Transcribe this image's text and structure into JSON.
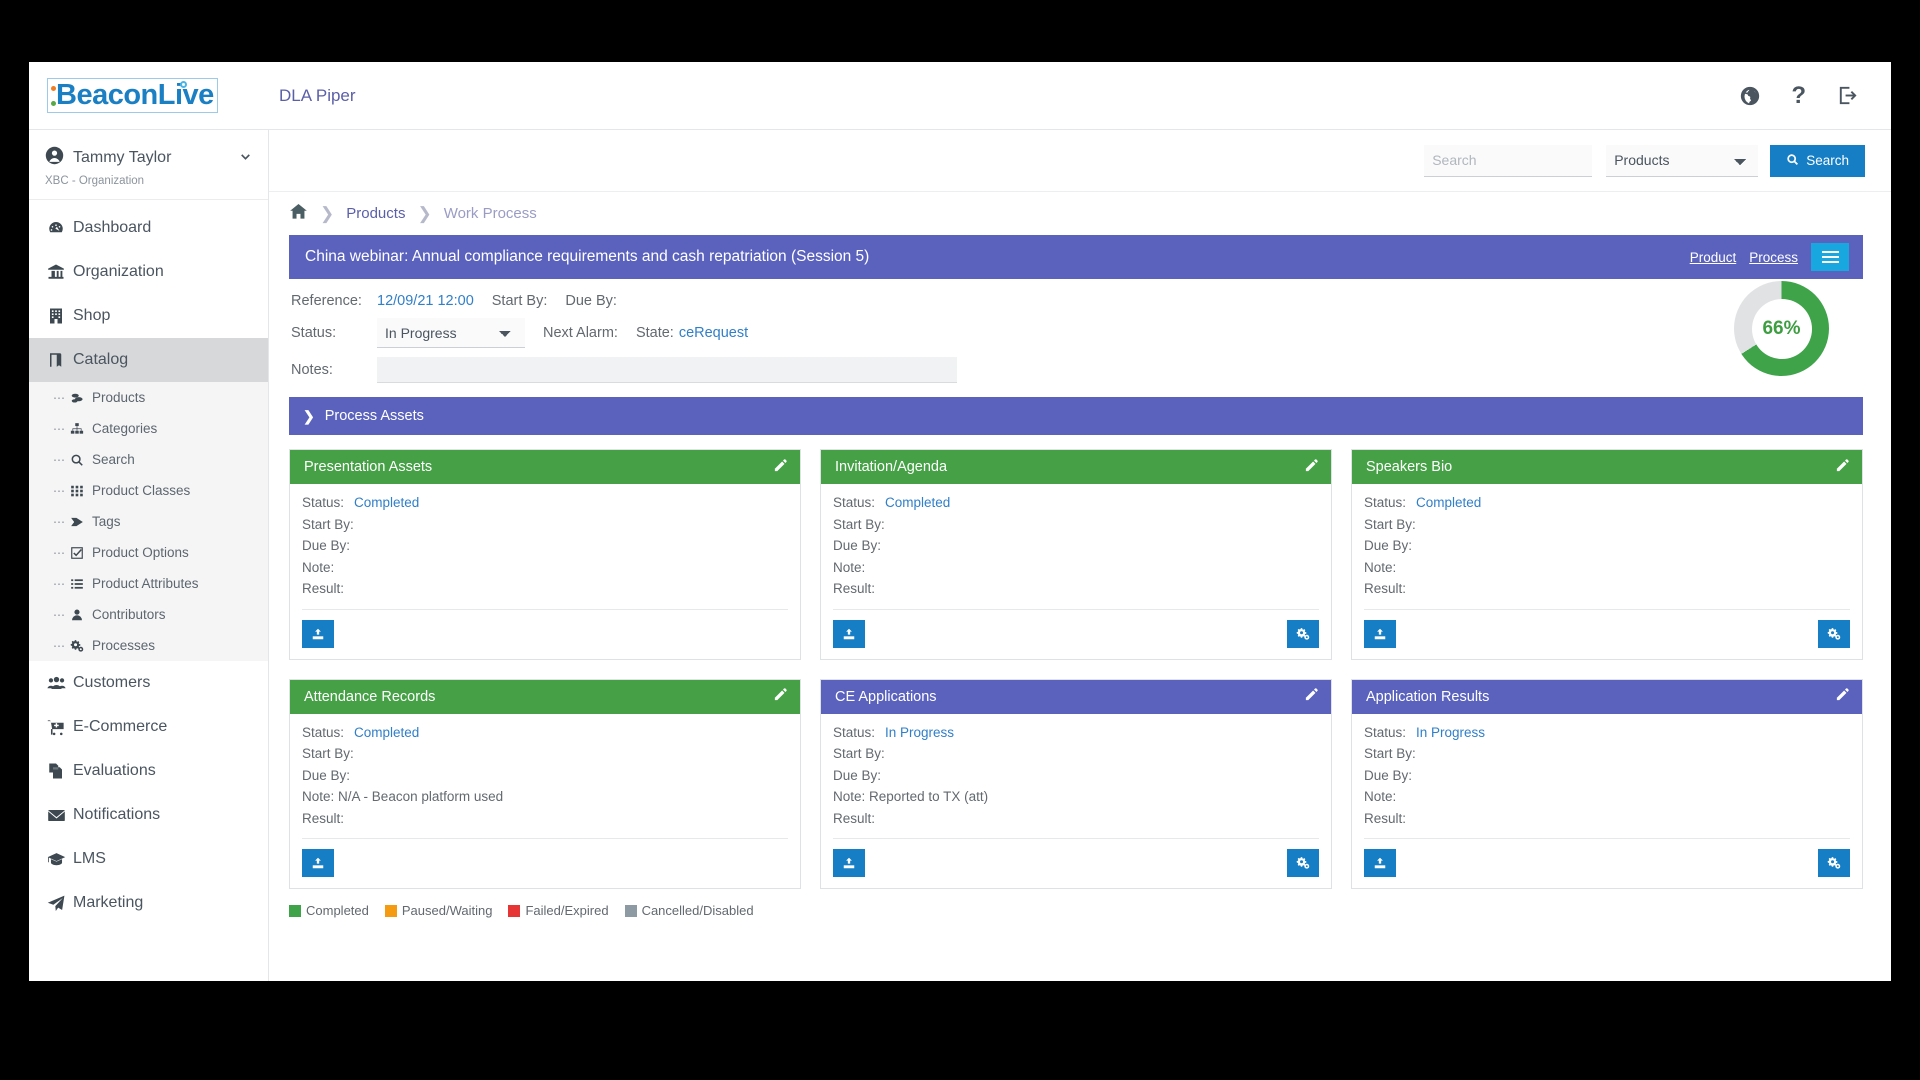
{
  "header": {
    "logo_text": "BeaconLive",
    "organization": "DLA Piper",
    "icons": [
      {
        "name": "globe-icon",
        "glyph": "ἱ0"
      },
      {
        "name": "help-icon",
        "glyph": "?"
      },
      {
        "name": "logout-icon",
        "glyph": "→"
      }
    ]
  },
  "sidebar": {
    "user": {
      "name": "Tammy Taylor",
      "subtitle": "XBC - Organization"
    },
    "items": [
      {
        "label": "Dashboard",
        "icon": "dashboard-icon",
        "active": false
      },
      {
        "label": "Organization",
        "icon": "bank-icon",
        "active": false
      },
      {
        "label": "Shop",
        "icon": "shop-icon",
        "active": false
      },
      {
        "label": "Catalog",
        "icon": "book-icon",
        "active": true
      },
      {
        "label": "Customers",
        "icon": "customers-icon",
        "active": false
      },
      {
        "label": "E-Commerce",
        "icon": "cart-icon",
        "active": false
      },
      {
        "label": "Evaluations",
        "icon": "copy-icon",
        "active": false
      },
      {
        "label": "Notifications",
        "icon": "envelope-icon",
        "active": false
      },
      {
        "label": "LMS",
        "icon": "graduation-cap-icon",
        "active": false
      },
      {
        "label": "Marketing",
        "icon": "paper-plane-icon",
        "active": false
      }
    ],
    "sub_items": [
      {
        "label": "Products",
        "icon": "products-icon"
      },
      {
        "label": "Categories",
        "icon": "sitemap-icon"
      },
      {
        "label": "Search",
        "icon": "search-icon"
      },
      {
        "label": "Product Classes",
        "icon": "grid-icon"
      },
      {
        "label": "Tags",
        "icon": "tag-icon"
      },
      {
        "label": "Product Options",
        "icon": "checkbox-icon"
      },
      {
        "label": "Product Attributes",
        "icon": "list-icon"
      },
      {
        "label": "Contributors",
        "icon": "user-icon"
      },
      {
        "label": "Processes",
        "icon": "cogs-icon"
      }
    ]
  },
  "search": {
    "placeholder": "Search",
    "value": "",
    "scope_selected": "Products",
    "scope_options": [
      "Products"
    ],
    "button_label": "Search"
  },
  "breadcrumb": {
    "home": "home-icon",
    "items": [
      "Products",
      "Work Process"
    ]
  },
  "work_process": {
    "title": "China webinar: Annual compliance requirements and cash repatriation (Session 5)",
    "links": {
      "product": "Product",
      "process": "Process"
    },
    "reference_label": "Reference:",
    "reference_value": "12/09/21 12:00",
    "start_by_label": "Start By:",
    "start_by_value": "",
    "due_by_label": "Due By:",
    "due_by_value": "",
    "status_label": "Status:",
    "status_value": "In Progress",
    "status_options": [
      "In Progress"
    ],
    "next_alarm_label": "Next Alarm:",
    "next_alarm_value": "",
    "state_label": "State:",
    "state_value": "ceRequest",
    "notes_label": "Notes:",
    "notes_value": "",
    "progress_percent": "66%",
    "progress_value": 66
  },
  "assets_section": {
    "label": "Process Assets"
  },
  "cards": [
    {
      "title": "Presentation Assets",
      "header_color": "green",
      "status_label": "Status:",
      "status_value": "Completed",
      "start_by_label": "Start By:",
      "start_by_value": "",
      "due_by_label": "Due By:",
      "due_by_value": "",
      "note_label": "Note:",
      "note_value": "",
      "result_label": "Result:",
      "result_value": "",
      "has_settings_button": false
    },
    {
      "title": "Invitation/Agenda",
      "header_color": "green",
      "status_label": "Status:",
      "status_value": "Completed",
      "start_by_label": "Start By:",
      "start_by_value": "",
      "due_by_label": "Due By:",
      "due_by_value": "",
      "note_label": "Note:",
      "note_value": "",
      "result_label": "Result:",
      "result_value": "",
      "has_settings_button": true
    },
    {
      "title": "Speakers Bio",
      "header_color": "green",
      "status_label": "Status:",
      "status_value": "Completed",
      "start_by_label": "Start By:",
      "start_by_value": "",
      "due_by_label": "Due By:",
      "due_by_value": "",
      "note_label": "Note:",
      "note_value": "",
      "result_label": "Result:",
      "result_value": "",
      "has_settings_button": true
    },
    {
      "title": "Attendance Records",
      "header_color": "green",
      "status_label": "Status:",
      "status_value": "Completed",
      "start_by_label": "Start By:",
      "start_by_value": "",
      "due_by_label": "Due By:",
      "due_by_value": "",
      "note_label": "Note:",
      "note_value": "N/A - Beacon platform used",
      "result_label": "Result:",
      "result_value": "",
      "has_settings_button": false
    },
    {
      "title": "CE Applications",
      "header_color": "blue",
      "status_label": "Status:",
      "status_value": "In Progress",
      "start_by_label": "Start By:",
      "start_by_value": "",
      "due_by_label": "Due By:",
      "due_by_value": "",
      "note_label": "Note:",
      "note_value": "Reported to TX (att)",
      "result_label": "Result:",
      "result_value": "",
      "has_settings_button": true
    },
    {
      "title": "Application Results",
      "header_color": "blue",
      "status_label": "Status:",
      "status_value": "In Progress",
      "start_by_label": "Start By:",
      "start_by_value": "",
      "due_by_label": "Due By:",
      "due_by_value": "",
      "note_label": "Note:",
      "note_value": "",
      "result_label": "Result:",
      "result_value": "",
      "has_settings_button": true
    }
  ],
  "legend": [
    {
      "label": "Completed",
      "color": "#3fa34a"
    },
    {
      "label": "Paused/Waiting",
      "color": "#f59b12"
    },
    {
      "label": "Failed/Expired",
      "color": "#e73434"
    },
    {
      "label": "Cancelled/Disabled",
      "color": "#8d9aa3"
    }
  ],
  "colors": {
    "accent_blue": "#157ec4",
    "purple": "#5a62bd",
    "green": "#46a146",
    "link": "#2f7fc9"
  }
}
